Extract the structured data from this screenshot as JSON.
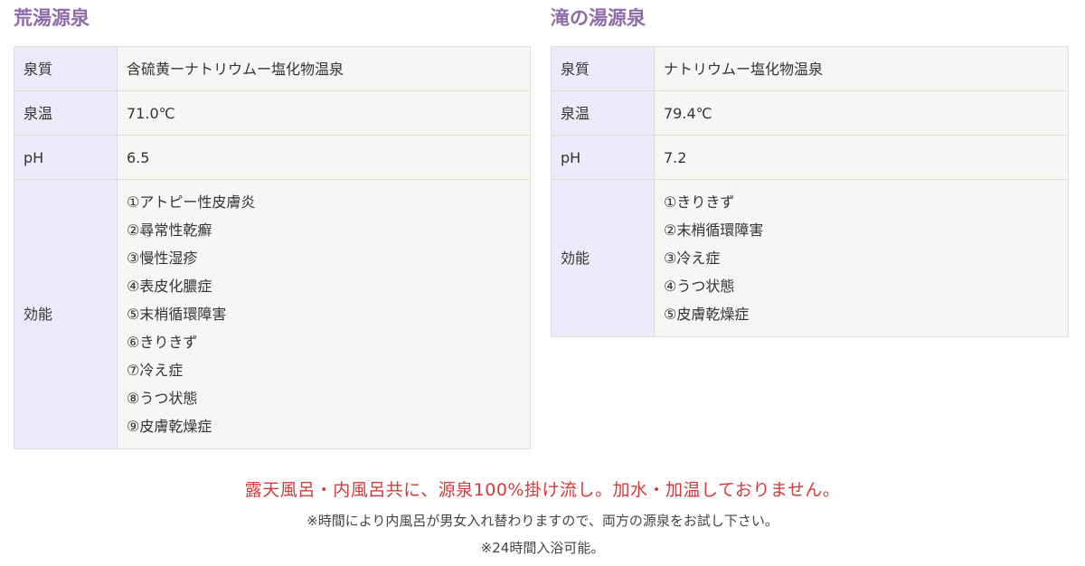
{
  "left": {
    "title": "荒湯源泉",
    "rows": [
      {
        "label": "泉質",
        "value": "含硫黄ーナトリウムー塩化物温泉"
      },
      {
        "label": "泉温",
        "value": "71.0℃"
      },
      {
        "label": "pH",
        "value": "6.5"
      }
    ],
    "effects_label": "効能",
    "effects": [
      "①アトピー性皮膚炎",
      "②尋常性乾癬",
      "③慢性湿疹",
      "④表皮化膿症",
      "⑤末梢循環障害",
      "⑥きりきず",
      "⑦冷え症",
      "⑧うつ状態",
      "⑨皮膚乾燥症"
    ]
  },
  "right": {
    "title": "滝の湯源泉",
    "rows": [
      {
        "label": "泉質",
        "value": "ナトリウムー塩化物温泉"
      },
      {
        "label": "泉温",
        "value": "79.4℃"
      },
      {
        "label": "pH",
        "value": "7.2"
      }
    ],
    "effects_label": "効能",
    "effects": [
      "①きりきず",
      "②末梢循環障害",
      "③冷え症",
      "④うつ状態",
      "⑤皮膚乾燥症"
    ]
  },
  "notes": {
    "main": "露天風呂・内風呂共に、源泉100%掛け流し。加水・加温しておりません。",
    "sub1": "※時間により内風呂が男女入れ替わりますので、両方の源泉をお試し下さい。",
    "sub2": "※24時間入浴可能。"
  },
  "colors": {
    "title": "#8e6aa8",
    "label_bg": "#efeafb",
    "value_bg": "#f8f6f4",
    "border": "#e2dcd6",
    "notice_red": "#d43a3a"
  }
}
